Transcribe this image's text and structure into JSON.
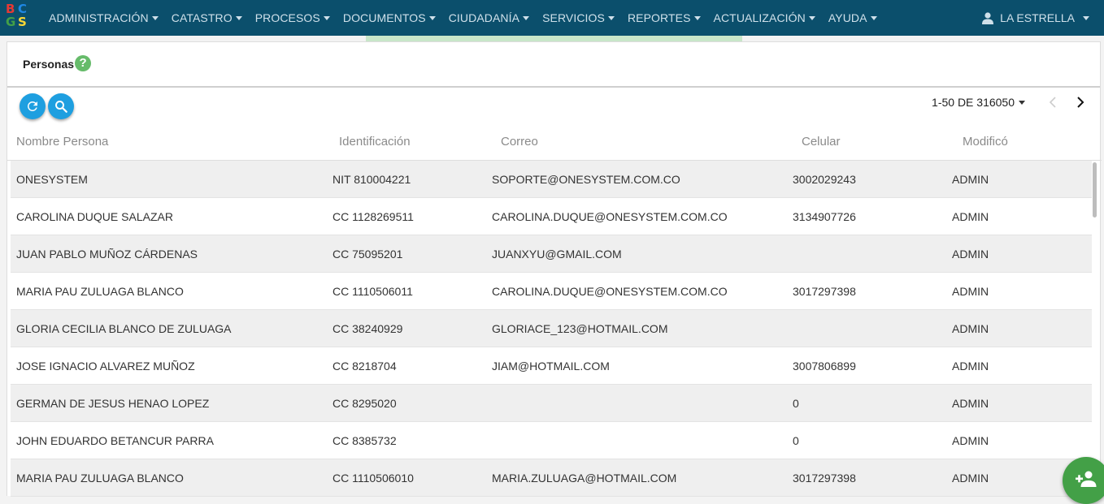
{
  "app": {
    "logo_letters": [
      "B",
      "C",
      "G",
      "S"
    ],
    "colors": {
      "navbar": "#0b4f6c",
      "accent": "#1e9fe0",
      "help": "#66bb6a",
      "add_button": "#43a047"
    }
  },
  "navbar": {
    "menu": [
      {
        "label": "ADMINISTRACIÓN"
      },
      {
        "label": "CATASTRO"
      },
      {
        "label": "PROCESOS"
      },
      {
        "label": "DOCUMENTOS"
      },
      {
        "label": "CIUDADANÍA"
      },
      {
        "label": "SERVICIOS"
      },
      {
        "label": "REPORTES"
      },
      {
        "label": "ACTUALIZACIÓN"
      },
      {
        "label": "AYUDA"
      }
    ],
    "user": {
      "label": "LA ESTRELLA",
      "icon": "user-icon"
    }
  },
  "page": {
    "title": "Personas",
    "help_icon": "?"
  },
  "toolbar": {
    "refresh_icon": "refresh-icon",
    "search_icon": "search-icon"
  },
  "pagination": {
    "range_label": "1-50 DE 316050",
    "prev_icon": "chevron-left-icon",
    "next_icon": "chevron-right-icon"
  },
  "table": {
    "columns": [
      "Nombre Persona",
      "Identificación",
      "Correo",
      "Celular",
      "Modificó"
    ],
    "rows": [
      {
        "nombre": "ONESYSTEM",
        "identificacion": "NIT 810004221",
        "correo": "SOPORTE@ONESYSTEM.COM.CO",
        "celular": "3002029243",
        "modifico": "ADMIN"
      },
      {
        "nombre": "CAROLINA DUQUE SALAZAR",
        "identificacion": "CC 1128269511",
        "correo": "CAROLINA.DUQUE@ONESYSTEM.COM.CO",
        "celular": "3134907726",
        "modifico": "ADMIN"
      },
      {
        "nombre": "JUAN PABLO MUÑOZ CÁRDENAS",
        "identificacion": "CC 75095201",
        "correo": "JUANXYU@GMAIL.COM",
        "celular": "",
        "modifico": "ADMIN"
      },
      {
        "nombre": "MARIA PAU ZULUAGA BLANCO",
        "identificacion": "CC 1110506011",
        "correo": "CAROLINA.DUQUE@ONESYSTEM.COM.CO",
        "celular": "3017297398",
        "modifico": "ADMIN"
      },
      {
        "nombre": "GLORIA CECILIA BLANCO DE ZULUAGA",
        "identificacion": "CC 38240929",
        "correo": "GLORIACE_123@HOTMAIL.COM",
        "celular": "",
        "modifico": "ADMIN"
      },
      {
        "nombre": "JOSE IGNACIO ALVAREZ MUÑOZ",
        "identificacion": "CC 8218704",
        "correo": "JIAM@HOTMAIL.COM",
        "celular": "3007806899",
        "modifico": "ADMIN"
      },
      {
        "nombre": "GERMAN DE JESUS HENAO LOPEZ",
        "identificacion": "CC 8295020",
        "correo": "",
        "celular": "0",
        "modifico": "ADMIN"
      },
      {
        "nombre": "JOHN EDUARDO BETANCUR PARRA",
        "identificacion": "CC 8385732",
        "correo": "",
        "celular": "0",
        "modifico": "ADMIN"
      },
      {
        "nombre": "MARIA PAU ZULUAGA BLANCO",
        "identificacion": "CC 1110506010",
        "correo": "MARIA.ZULUAGA@HOTMAIL.COM",
        "celular": "3017297398",
        "modifico": "ADMIN"
      }
    ]
  },
  "fab": {
    "add_person_icon": "add-person-icon"
  }
}
